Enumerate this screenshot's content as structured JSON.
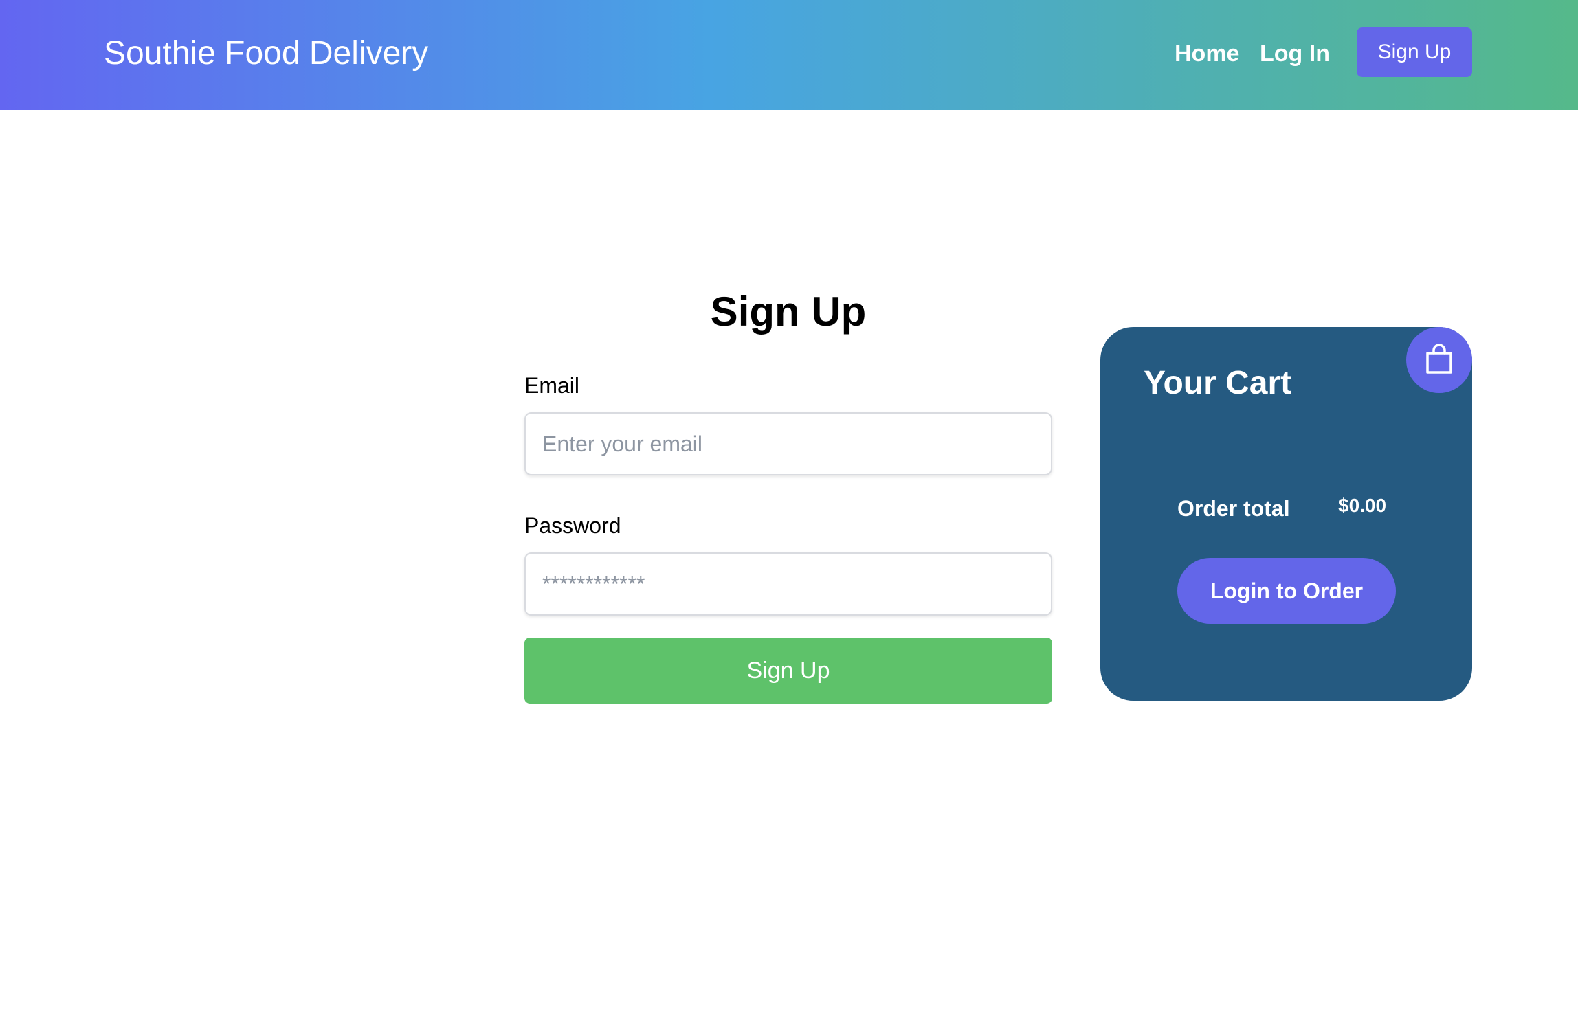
{
  "header": {
    "brand": "Southie Food Delivery",
    "nav": {
      "home": "Home",
      "login": "Log In",
      "signup": "Sign Up"
    },
    "gradient_colors": [
      "#6366f1",
      "#48a4e3",
      "#55b98a"
    ],
    "signup_button_color": "#6366e9"
  },
  "form": {
    "title": "Sign Up",
    "email_label": "Email",
    "email_placeholder": "Enter your email",
    "password_label": "Password",
    "password_placeholder": "************",
    "submit_label": "Sign Up",
    "submit_color": "#5ec26a"
  },
  "cart": {
    "title": "Your Cart",
    "icon": "shopping-bag-icon",
    "order_total_label": "Order total",
    "order_total_value": "$0.00",
    "button_label": "Login to Order",
    "card_color": "#255a81",
    "accent_color": "#6366e9"
  }
}
